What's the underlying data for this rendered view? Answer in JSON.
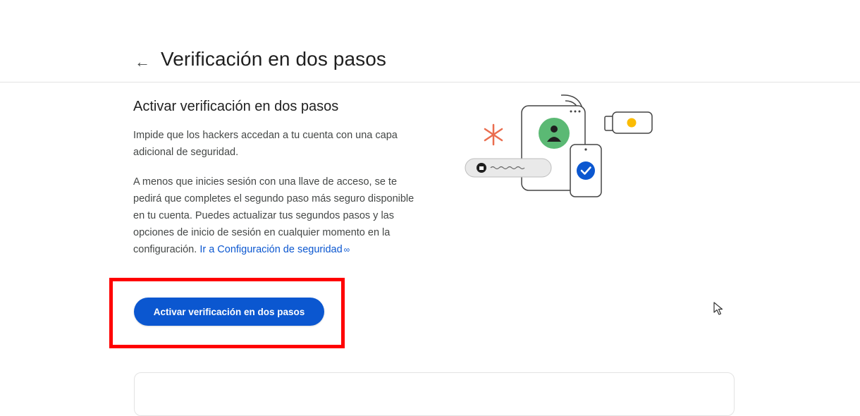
{
  "header": {
    "back_icon": "arrow-left-icon",
    "title": "Verificación en dos pasos"
  },
  "main": {
    "section_title": "Activar verificación en dos pasos",
    "intro": "Impide que los hackers accedan a tu cuenta con una capa adicional de seguridad.",
    "details": "A menos que inicies sesión con una llave de acceso, se te pedirá que completes el segundo paso más seguro disponible en tu cuenta. Puedes actualizar tus segundos pasos y las opciones de inicio de sesión en cualquier momento en la configuración.",
    "link_text": "Ir a Configuración de seguridad",
    "link_icon": "link-icon",
    "activate_button_label": "Activar verificación en dos pasos"
  },
  "colors": {
    "accent": "#0b57d0",
    "highlight": "#ff0000",
    "illustration_green": "#5bb974",
    "illustration_orange": "#ea6d4f",
    "illustration_yellow": "#fbbc04"
  }
}
